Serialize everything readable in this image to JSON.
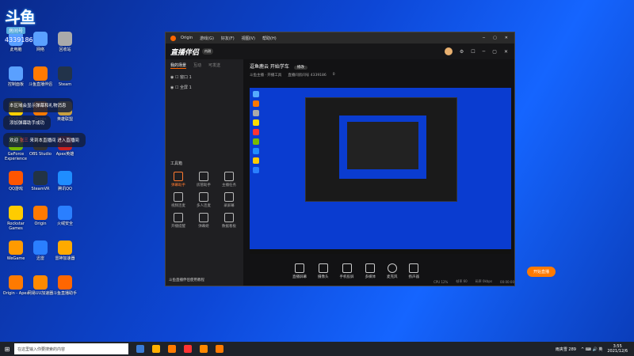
{
  "desktop": {
    "logo": {
      "big": "斗鱼",
      "tag": "房间号",
      "num": "4339186"
    },
    "icons": [
      {
        "label": "此电脑",
        "color": "#5aa0ff"
      },
      {
        "label": "网络",
        "color": "#5aa0ff"
      },
      {
        "label": "回收站",
        "color": "#aaaaaa"
      },
      {
        "label": "控制面板",
        "color": "#5aa0ff"
      },
      {
        "label": "斗鱼直播伴侣",
        "color": "#ff7a00"
      },
      {
        "label": "Steam",
        "color": "#22334a"
      },
      {
        "label": "QQ音乐",
        "color": "#ffd000"
      },
      {
        "label": "Origin",
        "color": "#ff7a00"
      },
      {
        "label": "英雄联盟",
        "color": "#c8a040"
      },
      {
        "label": "GeForce Experience",
        "color": "#76b900"
      },
      {
        "label": "OBS Studio",
        "color": "#333333"
      },
      {
        "label": "Apex英雄",
        "color": "#cc2222"
      },
      {
        "label": "QQ游戏",
        "color": "#ff5500"
      },
      {
        "label": "SteamVR",
        "color": "#223344"
      },
      {
        "label": "腾讯QQ",
        "color": "#1f8dff"
      },
      {
        "label": "Rockstar Games",
        "color": "#ffcc00"
      },
      {
        "label": "Origin",
        "color": "#ff7a00"
      },
      {
        "label": "火绒安全",
        "color": "#2a7fff"
      },
      {
        "label": "WeGame",
        "color": "#ff9a00"
      },
      {
        "label": "迅雷",
        "color": "#2a7fff"
      },
      {
        "label": "雷神加速器",
        "color": "#ffaa00"
      },
      {
        "label": "Origin - Apex",
        "color": "#ff7a00"
      },
      {
        "label": "网易UU加速器",
        "color": "#ff8a00"
      },
      {
        "label": "斗鱼直播助手",
        "color": "#ff6600"
      }
    ],
    "toasts": [
      {
        "text": "本区域会显示弹幕和礼物消息"
      },
      {
        "text": "添加弹幕助手成功"
      },
      {
        "pre": "欢迎 ",
        "hl": "张三",
        "post": " 来到本直播间 进入直播间"
      }
    ]
  },
  "window": {
    "title": "Origin",
    "menu": [
      "游戏(G)",
      "好友(F)",
      "视图(V)",
      "帮助(H)"
    ],
    "controls": [
      "─",
      "▢",
      "✕"
    ],
    "app": {
      "brand": "直播伴侣",
      "beta": "内测",
      "head_icons": [
        "⚙",
        "☐",
        "─",
        "▢",
        "✕"
      ],
      "side_tabs": [
        "我的场景",
        "互动",
        "可发送"
      ],
      "scenes": [
        "窗口 1",
        "全屏 1"
      ],
      "tools_title": "工具箱",
      "tools": [
        {
          "label": "弹幕助手",
          "hot": true
        },
        {
          "label": "房管助手",
          "hot": false
        },
        {
          "label": "主播任务",
          "hot": false
        },
        {
          "label": "视频连麦",
          "hot": false
        },
        {
          "label": "多人连麦",
          "hot": false
        },
        {
          "label": "录屏幕",
          "hot": false
        },
        {
          "label": "开播提醒",
          "hot": false
        },
        {
          "label": "弹幕姬",
          "hot": false
        },
        {
          "label": "数据看板",
          "hot": false
        }
      ],
      "side_footer": "斗鱼直播伴侣使用教程",
      "room_title": "逗鱼鹿云 开始学车",
      "room_edit": "修改",
      "sub": [
        "斗鱼主播 · 开播工具",
        "直播间房间号 4339186",
        "0"
      ],
      "controls": [
        {
          "label": "直播屏幕"
        },
        {
          "label": "摄像头"
        },
        {
          "label": "手机投屏"
        },
        {
          "label": "多媒体"
        },
        {
          "label": "麦克风"
        },
        {
          "label": "扬声器"
        }
      ],
      "go_live": "开始直播",
      "status": [
        "CPU 12%",
        "帧率 60",
        "码率 0kbps",
        "00:00:00"
      ]
    }
  },
  "taskbar": {
    "start": "⊞",
    "search_placeholder": "在这里输入你要搜索的内容",
    "icons": [
      "#3a7bd5",
      "#ffb000",
      "#ff7a00",
      "#ff3333",
      "#ff8800",
      "#ff7a00"
    ],
    "weather": "雨夹雪 289",
    "tray": "^ ⌨ 🔊 英",
    "time": "3:55",
    "date": "2021/12/6"
  },
  "colors": {
    "accent": "#ff7a00",
    "desktop": "#0d47d6"
  }
}
